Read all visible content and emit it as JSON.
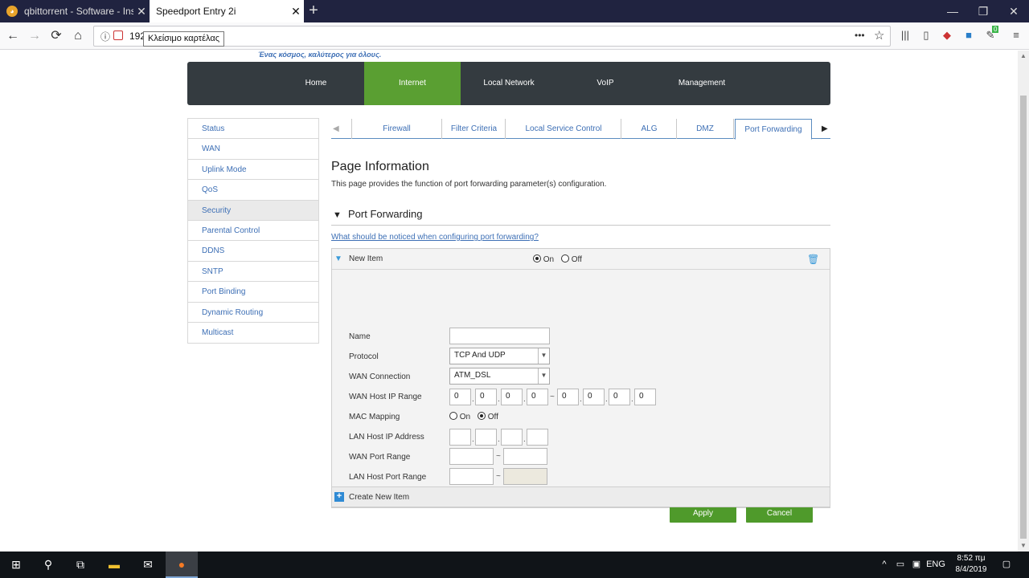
{
  "browser": {
    "tabs": [
      {
        "title": "qbittorrent - Software - Insom"
      },
      {
        "title": "Speedport Entry 2i"
      }
    ],
    "new_tab": "+",
    "window": {
      "minimize": "—",
      "maximize": "❐",
      "close": "✕"
    },
    "nav": {
      "back": "←",
      "forward": "→",
      "reload": "⟳",
      "home": "⌂"
    },
    "url_info": "ⓘ",
    "url": "192",
    "tooltip": "Κλείσιμο καρτέλας",
    "url_menu": "•••",
    "star": "☆",
    "toolbar_badge": "0"
  },
  "router": {
    "slogan": "Ένας κόσμος, καλύτερος για όλους.",
    "main_nav": [
      "Home",
      "Internet",
      "Local Network",
      "VoIP",
      "Management"
    ],
    "main_nav_active": "Internet",
    "sidebar": [
      "Status",
      "WAN",
      "Uplink Mode",
      "QoS",
      "Security",
      "Parental Control",
      "DDNS",
      "SNTP",
      "Port Binding",
      "Dynamic Routing",
      "Multicast"
    ],
    "sidebar_active": "Security",
    "subtabs": [
      "Firewall",
      "Filter Criteria",
      "Local Service Control",
      "ALG",
      "DMZ",
      "Port Forwarding"
    ],
    "subtab_active": "Port Forwarding",
    "subtab_prev": "◀",
    "subtab_next": "▶",
    "page_info": {
      "title": "Page Information",
      "description": "This page provides the function of port forwarding parameter(s) configuration."
    },
    "section": {
      "toggle": "▼",
      "title": "Port Forwarding",
      "help_link": "What should be noticed when configuring port forwarding?"
    },
    "item": {
      "toggle": "▼",
      "label": "New Item",
      "on_label": "On",
      "off_label": "Off",
      "state": "On"
    },
    "form": {
      "name_label": "Name",
      "name_value": "",
      "protocol_label": "Protocol",
      "protocol_value": "TCP And UDP",
      "wan_conn_label": "WAN Connection",
      "wan_conn_value": "ATM_DSL",
      "wan_host_ip_label": "WAN Host IP Range",
      "wan_ip_start": [
        "0",
        "0",
        "0",
        "0"
      ],
      "wan_ip_end": [
        "0",
        "0",
        "0",
        "0"
      ],
      "range_sep": "~",
      "octet_sep": ".",
      "mac_label": "MAC Mapping",
      "mac_on": "On",
      "mac_off": "Off",
      "mac_state": "Off",
      "lan_host_ip_label": "LAN Host IP Address",
      "wan_port_label": "WAN Port Range",
      "lan_port_label": "LAN Host Port Range"
    },
    "buttons": {
      "apply": "Apply",
      "cancel": "Cancel"
    },
    "create_new": "Create New Item",
    "create_icon": "+"
  },
  "taskbar": {
    "lang": "ENG",
    "time": "8:52 πμ",
    "date": "8/4/2019"
  },
  "colors": {
    "accent_green": "#5a9f32",
    "nav_dark": "#343b40",
    "link_blue": "#3d6fb5"
  }
}
